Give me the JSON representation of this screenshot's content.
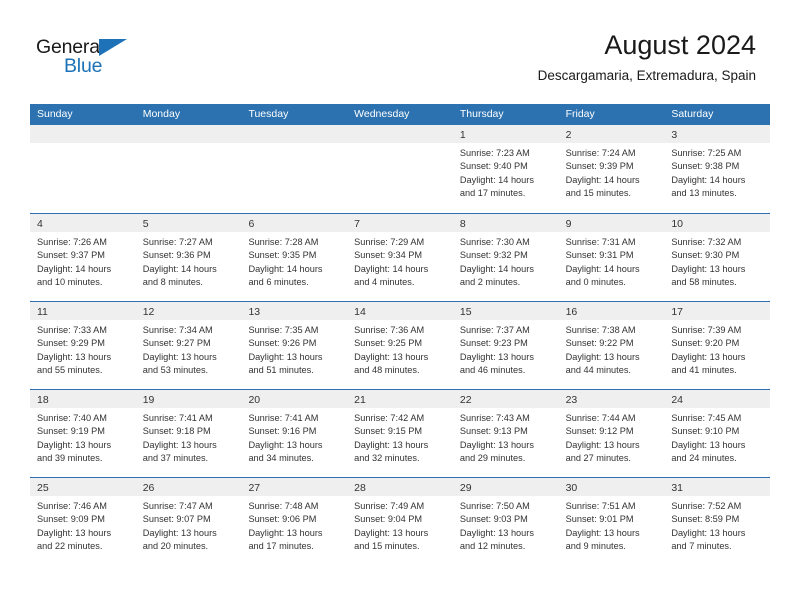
{
  "brand": {
    "name_part1": "General",
    "name_part2": "Blue",
    "accent_color": "#1d72b8"
  },
  "header": {
    "title": "August 2024",
    "subtitle": "Descargamaria, Extremadura, Spain"
  },
  "colors": {
    "header_blue": "#2c72b0",
    "daynum_band": "#efefef",
    "text": "#333333"
  },
  "weekdays": [
    "Sunday",
    "Monday",
    "Tuesday",
    "Wednesday",
    "Thursday",
    "Friday",
    "Saturday"
  ],
  "weeks": [
    [
      {
        "day": "",
        "sunrise": "",
        "sunset": "",
        "daylight_a": "",
        "daylight_b": ""
      },
      {
        "day": "",
        "sunrise": "",
        "sunset": "",
        "daylight_a": "",
        "daylight_b": ""
      },
      {
        "day": "",
        "sunrise": "",
        "sunset": "",
        "daylight_a": "",
        "daylight_b": ""
      },
      {
        "day": "",
        "sunrise": "",
        "sunset": "",
        "daylight_a": "",
        "daylight_b": ""
      },
      {
        "day": "1",
        "sunrise": "Sunrise: 7:23 AM",
        "sunset": "Sunset: 9:40 PM",
        "daylight_a": "Daylight: 14 hours",
        "daylight_b": "and 17 minutes."
      },
      {
        "day": "2",
        "sunrise": "Sunrise: 7:24 AM",
        "sunset": "Sunset: 9:39 PM",
        "daylight_a": "Daylight: 14 hours",
        "daylight_b": "and 15 minutes."
      },
      {
        "day": "3",
        "sunrise": "Sunrise: 7:25 AM",
        "sunset": "Sunset: 9:38 PM",
        "daylight_a": "Daylight: 14 hours",
        "daylight_b": "and 13 minutes."
      }
    ],
    [
      {
        "day": "4",
        "sunrise": "Sunrise: 7:26 AM",
        "sunset": "Sunset: 9:37 PM",
        "daylight_a": "Daylight: 14 hours",
        "daylight_b": "and 10 minutes."
      },
      {
        "day": "5",
        "sunrise": "Sunrise: 7:27 AM",
        "sunset": "Sunset: 9:36 PM",
        "daylight_a": "Daylight: 14 hours",
        "daylight_b": "and 8 minutes."
      },
      {
        "day": "6",
        "sunrise": "Sunrise: 7:28 AM",
        "sunset": "Sunset: 9:35 PM",
        "daylight_a": "Daylight: 14 hours",
        "daylight_b": "and 6 minutes."
      },
      {
        "day": "7",
        "sunrise": "Sunrise: 7:29 AM",
        "sunset": "Sunset: 9:34 PM",
        "daylight_a": "Daylight: 14 hours",
        "daylight_b": "and 4 minutes."
      },
      {
        "day": "8",
        "sunrise": "Sunrise: 7:30 AM",
        "sunset": "Sunset: 9:32 PM",
        "daylight_a": "Daylight: 14 hours",
        "daylight_b": "and 2 minutes."
      },
      {
        "day": "9",
        "sunrise": "Sunrise: 7:31 AM",
        "sunset": "Sunset: 9:31 PM",
        "daylight_a": "Daylight: 14 hours",
        "daylight_b": "and 0 minutes."
      },
      {
        "day": "10",
        "sunrise": "Sunrise: 7:32 AM",
        "sunset": "Sunset: 9:30 PM",
        "daylight_a": "Daylight: 13 hours",
        "daylight_b": "and 58 minutes."
      }
    ],
    [
      {
        "day": "11",
        "sunrise": "Sunrise: 7:33 AM",
        "sunset": "Sunset: 9:29 PM",
        "daylight_a": "Daylight: 13 hours",
        "daylight_b": "and 55 minutes."
      },
      {
        "day": "12",
        "sunrise": "Sunrise: 7:34 AM",
        "sunset": "Sunset: 9:27 PM",
        "daylight_a": "Daylight: 13 hours",
        "daylight_b": "and 53 minutes."
      },
      {
        "day": "13",
        "sunrise": "Sunrise: 7:35 AM",
        "sunset": "Sunset: 9:26 PM",
        "daylight_a": "Daylight: 13 hours",
        "daylight_b": "and 51 minutes."
      },
      {
        "day": "14",
        "sunrise": "Sunrise: 7:36 AM",
        "sunset": "Sunset: 9:25 PM",
        "daylight_a": "Daylight: 13 hours",
        "daylight_b": "and 48 minutes."
      },
      {
        "day": "15",
        "sunrise": "Sunrise: 7:37 AM",
        "sunset": "Sunset: 9:23 PM",
        "daylight_a": "Daylight: 13 hours",
        "daylight_b": "and 46 minutes."
      },
      {
        "day": "16",
        "sunrise": "Sunrise: 7:38 AM",
        "sunset": "Sunset: 9:22 PM",
        "daylight_a": "Daylight: 13 hours",
        "daylight_b": "and 44 minutes."
      },
      {
        "day": "17",
        "sunrise": "Sunrise: 7:39 AM",
        "sunset": "Sunset: 9:20 PM",
        "daylight_a": "Daylight: 13 hours",
        "daylight_b": "and 41 minutes."
      }
    ],
    [
      {
        "day": "18",
        "sunrise": "Sunrise: 7:40 AM",
        "sunset": "Sunset: 9:19 PM",
        "daylight_a": "Daylight: 13 hours",
        "daylight_b": "and 39 minutes."
      },
      {
        "day": "19",
        "sunrise": "Sunrise: 7:41 AM",
        "sunset": "Sunset: 9:18 PM",
        "daylight_a": "Daylight: 13 hours",
        "daylight_b": "and 37 minutes."
      },
      {
        "day": "20",
        "sunrise": "Sunrise: 7:41 AM",
        "sunset": "Sunset: 9:16 PM",
        "daylight_a": "Daylight: 13 hours",
        "daylight_b": "and 34 minutes."
      },
      {
        "day": "21",
        "sunrise": "Sunrise: 7:42 AM",
        "sunset": "Sunset: 9:15 PM",
        "daylight_a": "Daylight: 13 hours",
        "daylight_b": "and 32 minutes."
      },
      {
        "day": "22",
        "sunrise": "Sunrise: 7:43 AM",
        "sunset": "Sunset: 9:13 PM",
        "daylight_a": "Daylight: 13 hours",
        "daylight_b": "and 29 minutes."
      },
      {
        "day": "23",
        "sunrise": "Sunrise: 7:44 AM",
        "sunset": "Sunset: 9:12 PM",
        "daylight_a": "Daylight: 13 hours",
        "daylight_b": "and 27 minutes."
      },
      {
        "day": "24",
        "sunrise": "Sunrise: 7:45 AM",
        "sunset": "Sunset: 9:10 PM",
        "daylight_a": "Daylight: 13 hours",
        "daylight_b": "and 24 minutes."
      }
    ],
    [
      {
        "day": "25",
        "sunrise": "Sunrise: 7:46 AM",
        "sunset": "Sunset: 9:09 PM",
        "daylight_a": "Daylight: 13 hours",
        "daylight_b": "and 22 minutes."
      },
      {
        "day": "26",
        "sunrise": "Sunrise: 7:47 AM",
        "sunset": "Sunset: 9:07 PM",
        "daylight_a": "Daylight: 13 hours",
        "daylight_b": "and 20 minutes."
      },
      {
        "day": "27",
        "sunrise": "Sunrise: 7:48 AM",
        "sunset": "Sunset: 9:06 PM",
        "daylight_a": "Daylight: 13 hours",
        "daylight_b": "and 17 minutes."
      },
      {
        "day": "28",
        "sunrise": "Sunrise: 7:49 AM",
        "sunset": "Sunset: 9:04 PM",
        "daylight_a": "Daylight: 13 hours",
        "daylight_b": "and 15 minutes."
      },
      {
        "day": "29",
        "sunrise": "Sunrise: 7:50 AM",
        "sunset": "Sunset: 9:03 PM",
        "daylight_a": "Daylight: 13 hours",
        "daylight_b": "and 12 minutes."
      },
      {
        "day": "30",
        "sunrise": "Sunrise: 7:51 AM",
        "sunset": "Sunset: 9:01 PM",
        "daylight_a": "Daylight: 13 hours",
        "daylight_b": "and 9 minutes."
      },
      {
        "day": "31",
        "sunrise": "Sunrise: 7:52 AM",
        "sunset": "Sunset: 8:59 PM",
        "daylight_a": "Daylight: 13 hours",
        "daylight_b": "and 7 minutes."
      }
    ]
  ]
}
